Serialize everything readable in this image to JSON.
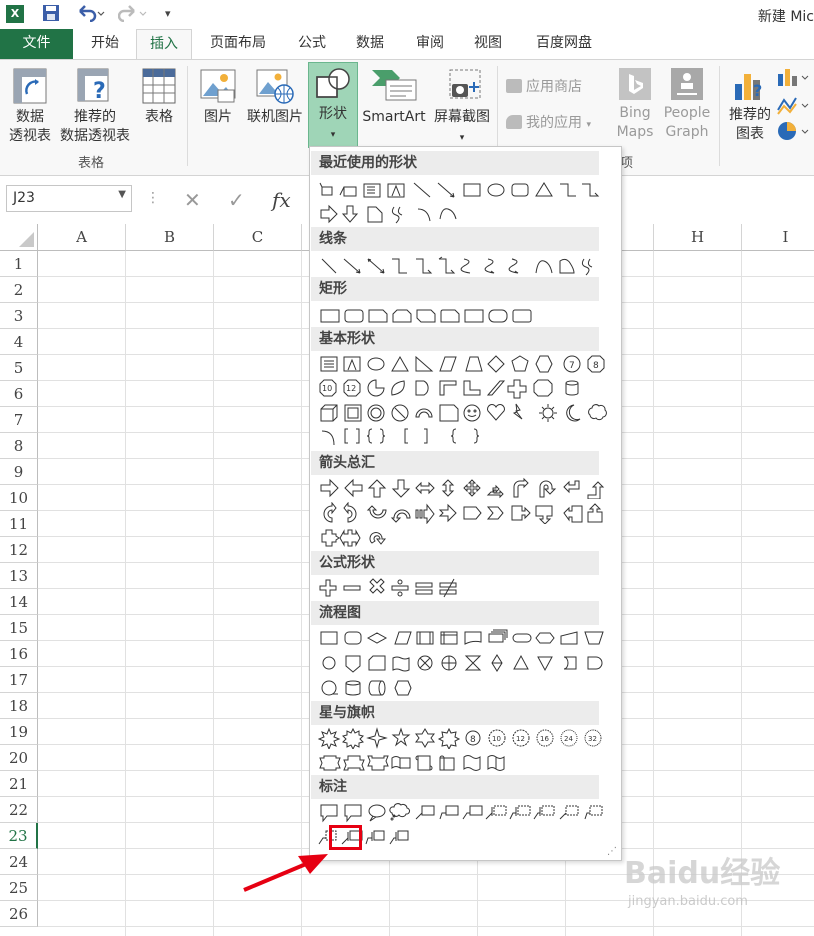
{
  "titlebar": {
    "app_badge": "X",
    "title": "新建 Mic"
  },
  "tabs": [
    {
      "label": "文件"
    },
    {
      "label": "开始"
    },
    {
      "label": "插入"
    },
    {
      "label": "页面布局"
    },
    {
      "label": "公式"
    },
    {
      "label": "数据"
    },
    {
      "label": "审阅"
    },
    {
      "label": "视图"
    },
    {
      "label": "百度网盘"
    }
  ],
  "ribbon": {
    "pivot": {
      "line1": "数据",
      "line2": "透视表"
    },
    "recommended_pivot": {
      "line1": "推荐的",
      "line2": "数据透视表"
    },
    "table": "表格",
    "group_tables": "表格",
    "picture": "图片",
    "online_picture": "联机图片",
    "shapes": "形状",
    "smartart": "SmartArt",
    "screenshot": "屏幕截图",
    "app_store": "应用商店",
    "my_apps": "我的应用",
    "bing_maps": {
      "line1": "Bing",
      "line2": "Maps"
    },
    "people_graph": {
      "line1": "People",
      "line2": "Graph"
    },
    "group_apps_tail": "项",
    "recommended_charts": {
      "line1": "推荐的",
      "line2": "图表"
    }
  },
  "formula_bar": {
    "name_box": "J23",
    "fx": "fx"
  },
  "grid": {
    "columns": [
      "A",
      "B",
      "C",
      "H",
      "I"
    ],
    "rows": [
      "1",
      "2",
      "3",
      "4",
      "5",
      "6",
      "7",
      "8",
      "9",
      "10",
      "11",
      "12",
      "13",
      "14",
      "15",
      "16",
      "17",
      "18",
      "19",
      "20",
      "21",
      "22",
      "23",
      "24",
      "25",
      "26"
    ]
  },
  "shapes_menu": {
    "sections": [
      "最近使用的形状",
      "线条",
      "矩形",
      "基本形状",
      "箭头总汇",
      "公式形状",
      "流程图",
      "星与旗帜",
      "标注"
    ]
  },
  "watermark": {
    "brand": "Baidu经验",
    "url": "jingyan.baidu.com"
  },
  "colors": {
    "excel_green": "#217346",
    "highlight_red": "#e60012",
    "shapes_button_bg": "#9fd5b7"
  }
}
